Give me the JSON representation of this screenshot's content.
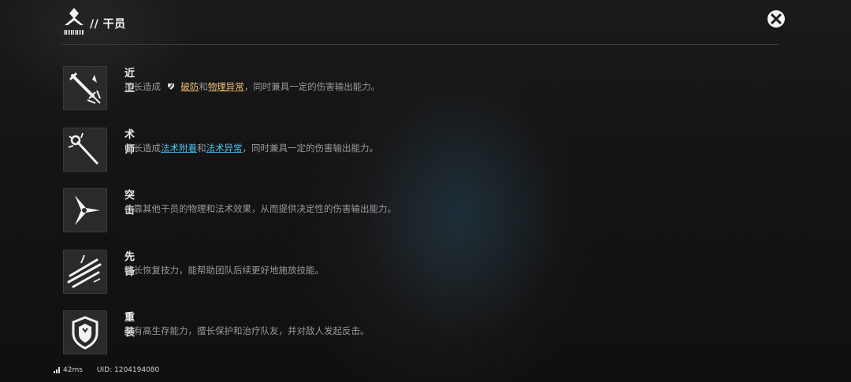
{
  "header": {
    "title": "// 干员",
    "logo_icon": "operator-logo-icon"
  },
  "close": {
    "icon": "close-icon"
  },
  "classes": [
    {
      "name": "近卫",
      "icon": "guard-sword-icon",
      "desc": {
        "prefix": "擅长造成",
        "kw1_icon": "shield-break-icon",
        "kw1": "破防",
        "join": "和",
        "kw2": "物理异常",
        "suffix": "，同时兼具一定的伤害输出能力。"
      }
    },
    {
      "name": "术师",
      "icon": "caster-staff-icon",
      "desc": {
        "prefix": "擅长造成",
        "kw1": "法术附着",
        "join": "和",
        "kw2": "法术异常",
        "suffix": "，同时兼具一定的伤害输出能力。"
      }
    },
    {
      "name": "突击",
      "icon": "striker-shuriken-icon",
      "desc": {
        "text": "依靠其他干员的物理和法术效果，从而提供决定性的伤害输出能力。"
      }
    },
    {
      "name": "先锋",
      "icon": "vanguard-slash-icon",
      "desc": {
        "text": "擅长恢复技力，能帮助团队后续更好地施放技能。"
      }
    },
    {
      "name": "重装",
      "icon": "defender-shield-icon",
      "desc": {
        "text": "拥有高生存能力，擅长保护和治疗队友，并对敌人发起反击。"
      }
    }
  ],
  "footer": {
    "signal_icon": "signal-bars-icon",
    "ping": "42ms",
    "uid": "UID: 1204194080"
  },
  "colors": {
    "keyword_physical": "#f0c47a",
    "keyword_arts": "#4fc4ee",
    "panel_icon_bg": "#2a2a2a"
  }
}
